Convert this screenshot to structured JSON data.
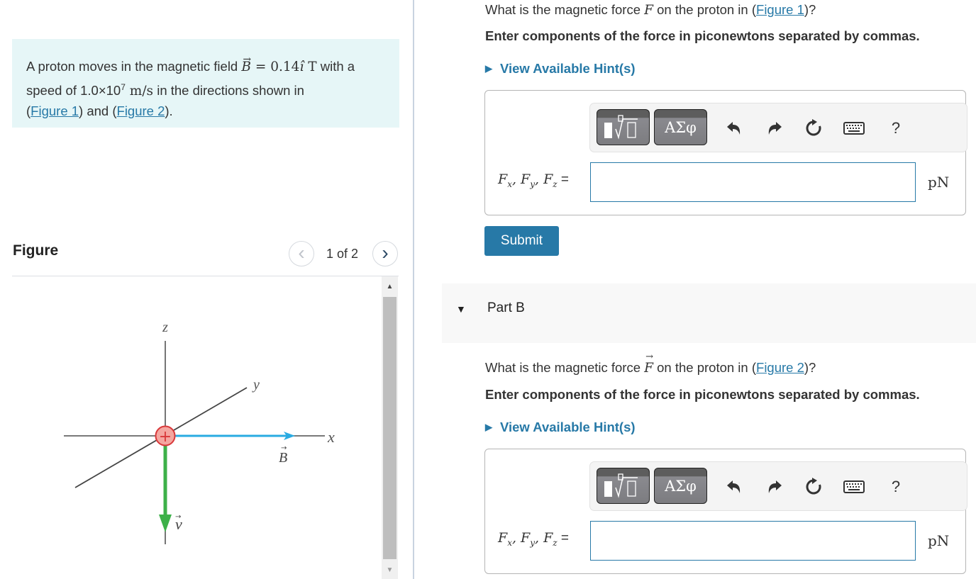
{
  "intro": {
    "text_1": "A proton moves in the magnetic field ",
    "B_symbol": "B",
    "equals": " = 0.14",
    "i_hat": "î",
    "unit_T": " T",
    "text_2": " with a speed of 1.0×10",
    "exponent": "7",
    "speed_unit": " m/s",
    "text_3": " in the directions shown in",
    "paren_open": "(",
    "figure1_link": "Figure 1",
    "and_text": ") and (",
    "figure2_link": "Figure 2",
    "paren_close": ")."
  },
  "figure_panel": {
    "title": "Figure",
    "page_indicator": "1 of 2",
    "prev_icon": "‹",
    "next_icon": "›",
    "scroll_up_icon": "▲",
    "scroll_down_icon": "▼",
    "diagram": {
      "axis_labels": {
        "z": "z",
        "y": "y",
        "x": "x"
      },
      "charge_symbol": "+",
      "B_label": "B",
      "v_label": "v",
      "colors": {
        "axis": "#666666",
        "B_vector": "#29abe2",
        "v_vector": "#3db149",
        "charge_fill": "#f4a6a0",
        "charge_stroke": "#d9383a"
      }
    }
  },
  "part_a": {
    "question_pre": "What is the magnetic force ",
    "question_symbol": "F",
    "question_mid": " on the proton in (",
    "figure_link": "Figure 1",
    "question_post": ")?",
    "instruction": "Enter components of the force in piconewtons separated by commas.",
    "hint_label": "View Available Hint(s)",
    "toolbar": {
      "templates_icon": "templates-icon",
      "symbols_label": "ΑΣφ",
      "help_label": "?"
    },
    "answer_label": "F",
    "answer_value": "",
    "unit": "pN",
    "submit_label": "Submit"
  },
  "part_b": {
    "header": "Part B",
    "caret": "▼",
    "question_pre": "What is the magnetic force ",
    "question_symbol": "F",
    "question_mid": " on the proton in (",
    "figure_link": "Figure 2",
    "question_post": ")?",
    "instruction": "Enter components of the force in piconewtons separated by commas.",
    "hint_label": "View Available Hint(s)",
    "toolbar": {
      "symbols_label": "ΑΣφ",
      "help_label": "?"
    },
    "answer_value": "",
    "unit": "pN"
  },
  "colors": {
    "accent": "#2779a7",
    "intro_bg": "#e6f6f7",
    "part_header_bg": "#f8f8f8"
  }
}
